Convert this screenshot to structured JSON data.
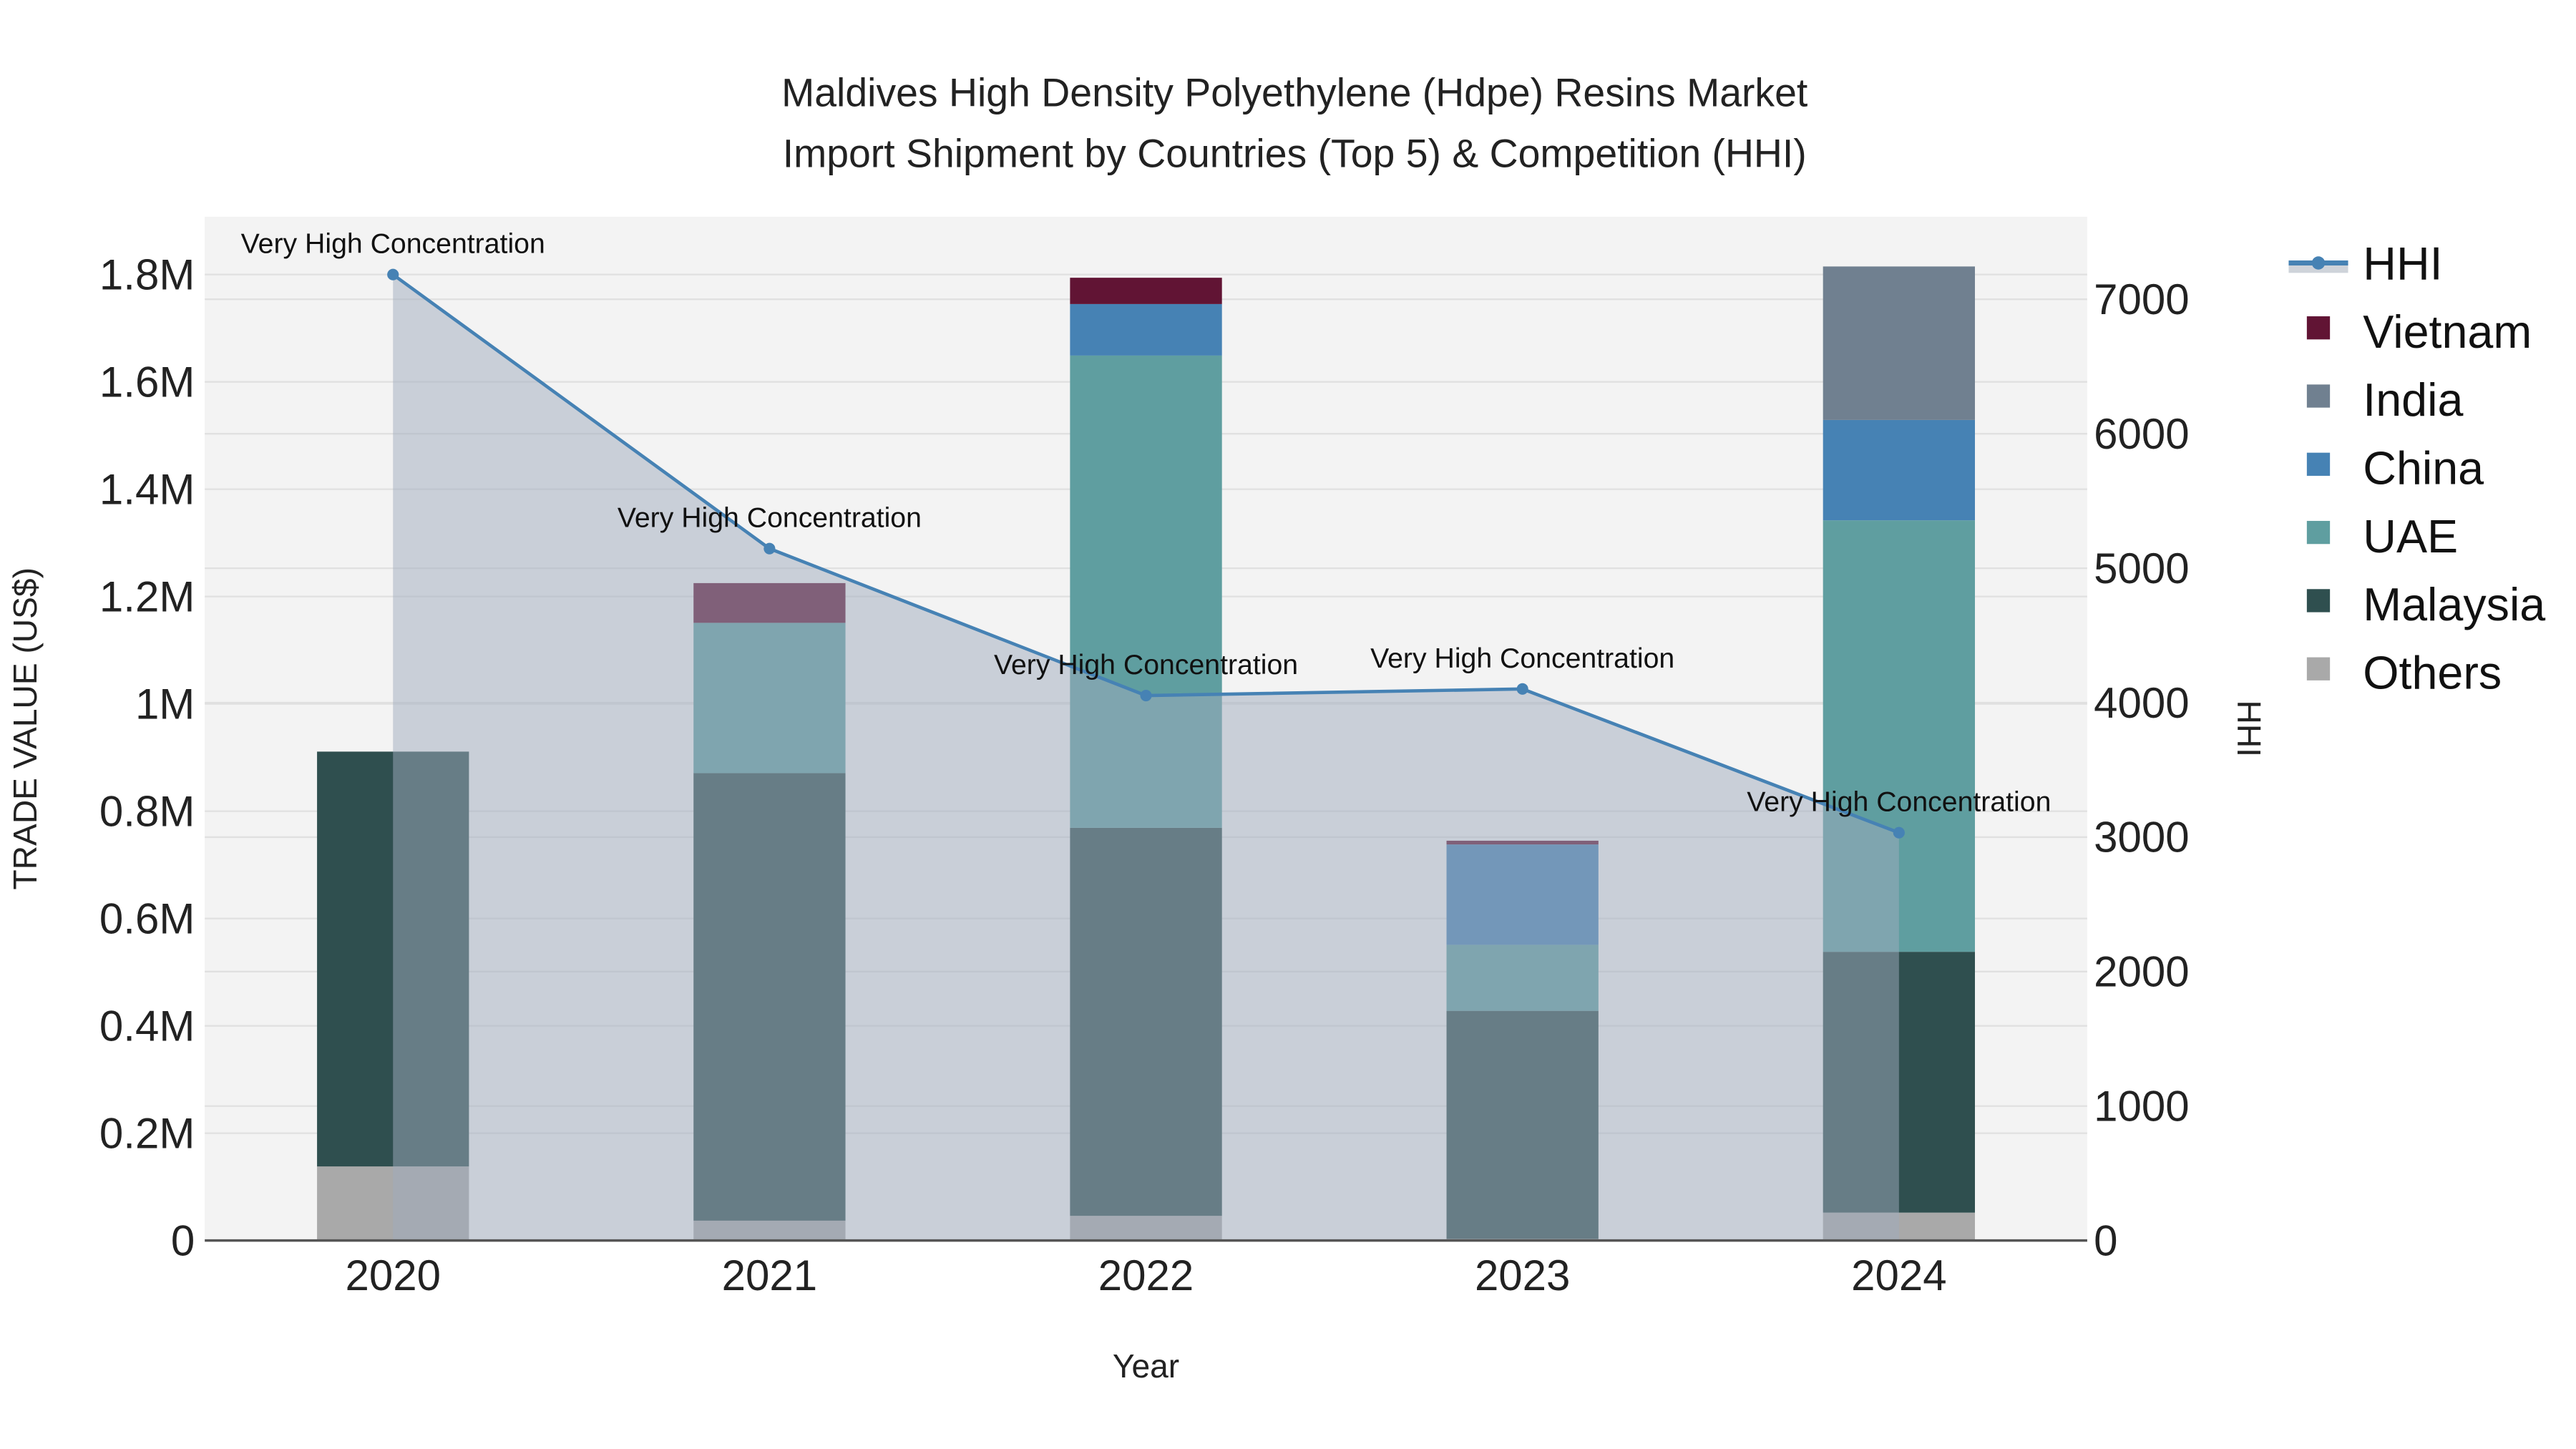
{
  "chart_data": {
    "type": "bar",
    "title_line1": "Maldives High Density Polyethylene (Hdpe) Resins Market",
    "title_line2": "Import Shipment by Countries (Top 5) & Competition (HHI)",
    "xlabel": "Year",
    "ylabel": "TRADE VALUE (US$)",
    "y2label": "HHI",
    "categories": [
      "2020",
      "2021",
      "2022",
      "2023",
      "2024"
    ],
    "ylim": [
      0,
      1900000
    ],
    "y2lim": [
      0,
      7600
    ],
    "yticks": [
      {
        "v": 0,
        "label": "0"
      },
      {
        "v": 200000,
        "label": "0.2M"
      },
      {
        "v": 400000,
        "label": "0.4M"
      },
      {
        "v": 600000,
        "label": "0.6M"
      },
      {
        "v": 800000,
        "label": "0.8M"
      },
      {
        "v": 1000000,
        "label": "1M"
      },
      {
        "v": 1200000,
        "label": "1.2M"
      },
      {
        "v": 1400000,
        "label": "1.4M"
      },
      {
        "v": 1600000,
        "label": "1.6M"
      },
      {
        "v": 1800000,
        "label": "1.8M"
      }
    ],
    "y2ticks": [
      {
        "v": 0,
        "label": "0"
      },
      {
        "v": 1000,
        "label": "1000"
      },
      {
        "v": 2000,
        "label": "2000"
      },
      {
        "v": 3000,
        "label": "3000"
      },
      {
        "v": 4000,
        "label": "4000"
      },
      {
        "v": 5000,
        "label": "5000"
      },
      {
        "v": 6000,
        "label": "6000"
      },
      {
        "v": 7000,
        "label": "7000"
      }
    ],
    "series": [
      {
        "name": "Others",
        "color": "#a9a9a9",
        "values": [
          138000,
          37000,
          46000,
          3000,
          52000
        ]
      },
      {
        "name": "Malaysia",
        "color": "#2f4f4f",
        "values": [
          773000,
          834000,
          723000,
          425000,
          486000
        ]
      },
      {
        "name": "UAE",
        "color": "#5f9ea0",
        "values": [
          0,
          280000,
          880000,
          123000,
          804000
        ]
      },
      {
        "name": "China",
        "color": "#4682b4",
        "values": [
          0,
          0,
          96000,
          187000,
          187000
        ]
      },
      {
        "name": "India",
        "color": "#708090",
        "values": [
          0,
          0,
          0,
          0,
          286000
        ]
      },
      {
        "name": "Vietnam",
        "color": "#611434",
        "values": [
          0,
          74000,
          49000,
          7000,
          0
        ]
      }
    ],
    "hhi": {
      "name": "HHI",
      "color": "#4682b4",
      "values": [
        7184,
        5146,
        4053,
        4102,
        3033
      ],
      "annotations": [
        "Very High Concentration",
        "Very High Concentration",
        "Very High Concentration",
        "Very High Concentration",
        "Very High Concentration"
      ]
    },
    "legend": [
      "HHI",
      "Vietnam",
      "India",
      "China",
      "UAE",
      "Malaysia",
      "Others"
    ],
    "legend_placement": "right",
    "grid": true
  }
}
